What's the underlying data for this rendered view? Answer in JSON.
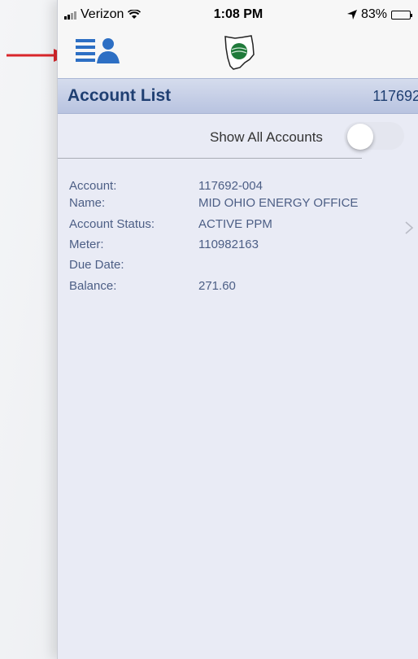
{
  "status_bar": {
    "carrier": "Verizon",
    "time": "1:08 PM",
    "battery_percent": "83%",
    "battery_level": 0.83
  },
  "nav": {
    "menu_icon": "account-menu-icon",
    "logo": "ohio-state-logo"
  },
  "header": {
    "title": "Account List",
    "account_number": "117692"
  },
  "toggle": {
    "label": "Show All Accounts",
    "on": false
  },
  "account": {
    "rows": [
      {
        "label": "Account:",
        "value": "117692-004"
      },
      {
        "label": "Name:",
        "value": "MID OHIO ENERGY OFFICE"
      },
      {
        "label": "Account Status:",
        "value": "ACTIVE PPM"
      },
      {
        "label": "Meter:",
        "value": "110982163"
      },
      {
        "label": "Due Date:",
        "value": ""
      },
      {
        "label": "Balance:",
        "value": "271.60"
      }
    ]
  },
  "colors": {
    "header_text": "#1f3f72",
    "menu_icon": "#2d6fc4",
    "annotation_arrow": "#d9262b",
    "logo_green": "#1f7a3a"
  }
}
